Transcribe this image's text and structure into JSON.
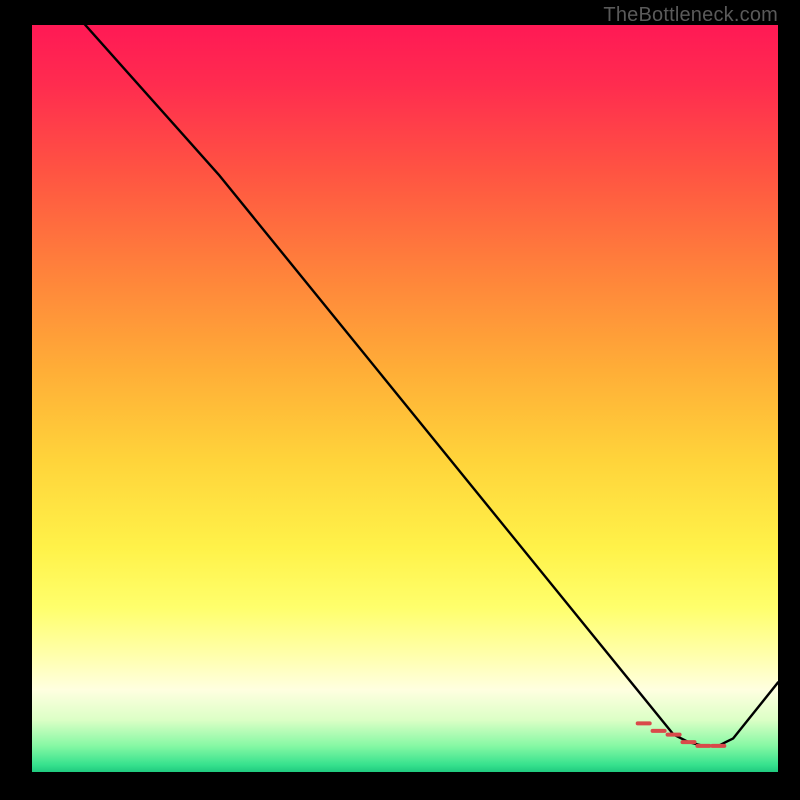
{
  "watermark": "TheBottleneck.com",
  "chart_data": {
    "type": "line",
    "title": "",
    "xlabel": "",
    "ylabel": "",
    "xlim": [
      0,
      100
    ],
    "ylim": [
      0,
      100
    ],
    "series": [
      {
        "name": "curve",
        "x": [
          0,
          25,
          86,
          88,
          90,
          92,
          93,
          94,
          100
        ],
        "values": [
          108,
          80,
          5,
          4,
          3.5,
          3.5,
          4,
          4.5,
          12
        ]
      }
    ],
    "markers": {
      "x": [
        82,
        84,
        86,
        88,
        90,
        92
      ],
      "values": [
        6.5,
        5.5,
        5,
        4,
        3.5,
        3.5
      ]
    },
    "gradient_stops": [
      {
        "pct": 0,
        "color": "#ff1955"
      },
      {
        "pct": 20,
        "color": "#ff5542"
      },
      {
        "pct": 46,
        "color": "#ffad37"
      },
      {
        "pct": 70,
        "color": "#fff249"
      },
      {
        "pct": 89,
        "color": "#ffffe0"
      },
      {
        "pct": 100,
        "color": "#1fca7f"
      }
    ]
  }
}
